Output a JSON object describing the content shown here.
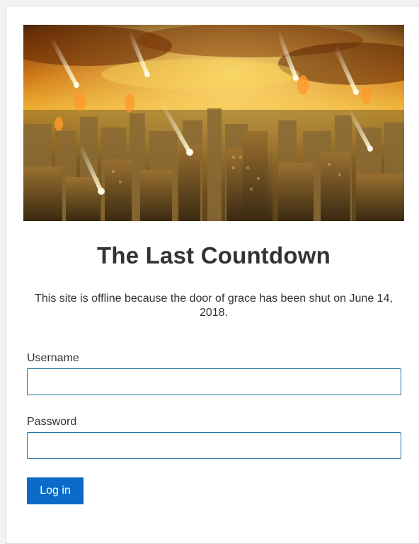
{
  "page": {
    "title": "The Last Countdown",
    "message": "This site is offline because the door of grace has been shut on June 14, 2018."
  },
  "hero": {
    "alt": "Burning city skyline under falling meteors",
    "palette": {
      "sky_top": "#5a2a04",
      "sky_glow": "#f6c23a",
      "city": "#6b4a1a",
      "meteor": "#fff3c4"
    }
  },
  "login_form": {
    "username_label": "Username",
    "username_value": "",
    "password_label": "Password",
    "password_value": "",
    "submit_label": "Log in"
  },
  "colors": {
    "accent": "#0a6cc8",
    "input_border": "#1f6f9e",
    "text": "#333333"
  }
}
